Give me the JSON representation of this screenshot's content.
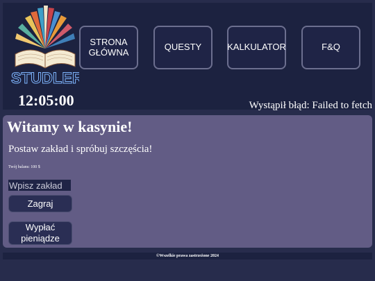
{
  "header": {
    "logo_text": "STUDLER",
    "clock": "12:05:00",
    "error": "Wystąpił błąd: Failed to fetch"
  },
  "nav": [
    {
      "label": "STRONA GŁÓWNA"
    },
    {
      "label": "QUESTY"
    },
    {
      "label": "KALKULATOR"
    },
    {
      "label": "F&Q"
    }
  ],
  "casino": {
    "title": "Witamy w kasynie!",
    "subtitle": "Postaw zakład i spróbuj szczęścia!",
    "balance": "Twój balans: 100 $",
    "bet_placeholder": "Wpisz zakład",
    "play_label": "Zagraj",
    "cashout_label": "Wypłać pieniądze"
  },
  "footer": {
    "text": "©Wszelkie prawa zastrzeżone 2024"
  },
  "colors": {
    "background": "#272c4c",
    "header": "#1c2240",
    "panel": "#625c85",
    "button": "#2a2e54"
  }
}
